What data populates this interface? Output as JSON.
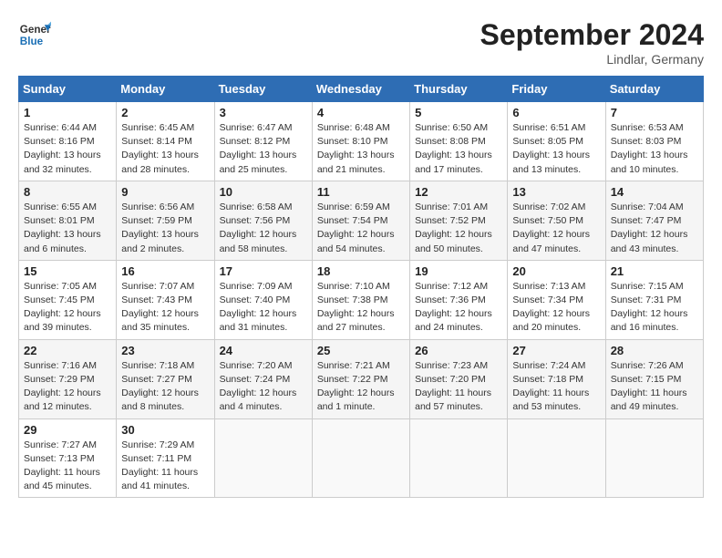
{
  "logo": {
    "line1": "General",
    "line2": "Blue"
  },
  "title": "September 2024",
  "location": "Lindlar, Germany",
  "headers": [
    "Sunday",
    "Monday",
    "Tuesday",
    "Wednesday",
    "Thursday",
    "Friday",
    "Saturday"
  ],
  "weeks": [
    [
      {
        "day": "1",
        "info": "Sunrise: 6:44 AM\nSunset: 8:16 PM\nDaylight: 13 hours\nand 32 minutes."
      },
      {
        "day": "2",
        "info": "Sunrise: 6:45 AM\nSunset: 8:14 PM\nDaylight: 13 hours\nand 28 minutes."
      },
      {
        "day": "3",
        "info": "Sunrise: 6:47 AM\nSunset: 8:12 PM\nDaylight: 13 hours\nand 25 minutes."
      },
      {
        "day": "4",
        "info": "Sunrise: 6:48 AM\nSunset: 8:10 PM\nDaylight: 13 hours\nand 21 minutes."
      },
      {
        "day": "5",
        "info": "Sunrise: 6:50 AM\nSunset: 8:08 PM\nDaylight: 13 hours\nand 17 minutes."
      },
      {
        "day": "6",
        "info": "Sunrise: 6:51 AM\nSunset: 8:05 PM\nDaylight: 13 hours\nand 13 minutes."
      },
      {
        "day": "7",
        "info": "Sunrise: 6:53 AM\nSunset: 8:03 PM\nDaylight: 13 hours\nand 10 minutes."
      }
    ],
    [
      {
        "day": "8",
        "info": "Sunrise: 6:55 AM\nSunset: 8:01 PM\nDaylight: 13 hours\nand 6 minutes."
      },
      {
        "day": "9",
        "info": "Sunrise: 6:56 AM\nSunset: 7:59 PM\nDaylight: 13 hours\nand 2 minutes."
      },
      {
        "day": "10",
        "info": "Sunrise: 6:58 AM\nSunset: 7:56 PM\nDaylight: 12 hours\nand 58 minutes."
      },
      {
        "day": "11",
        "info": "Sunrise: 6:59 AM\nSunset: 7:54 PM\nDaylight: 12 hours\nand 54 minutes."
      },
      {
        "day": "12",
        "info": "Sunrise: 7:01 AM\nSunset: 7:52 PM\nDaylight: 12 hours\nand 50 minutes."
      },
      {
        "day": "13",
        "info": "Sunrise: 7:02 AM\nSunset: 7:50 PM\nDaylight: 12 hours\nand 47 minutes."
      },
      {
        "day": "14",
        "info": "Sunrise: 7:04 AM\nSunset: 7:47 PM\nDaylight: 12 hours\nand 43 minutes."
      }
    ],
    [
      {
        "day": "15",
        "info": "Sunrise: 7:05 AM\nSunset: 7:45 PM\nDaylight: 12 hours\nand 39 minutes."
      },
      {
        "day": "16",
        "info": "Sunrise: 7:07 AM\nSunset: 7:43 PM\nDaylight: 12 hours\nand 35 minutes."
      },
      {
        "day": "17",
        "info": "Sunrise: 7:09 AM\nSunset: 7:40 PM\nDaylight: 12 hours\nand 31 minutes."
      },
      {
        "day": "18",
        "info": "Sunrise: 7:10 AM\nSunset: 7:38 PM\nDaylight: 12 hours\nand 27 minutes."
      },
      {
        "day": "19",
        "info": "Sunrise: 7:12 AM\nSunset: 7:36 PM\nDaylight: 12 hours\nand 24 minutes."
      },
      {
        "day": "20",
        "info": "Sunrise: 7:13 AM\nSunset: 7:34 PM\nDaylight: 12 hours\nand 20 minutes."
      },
      {
        "day": "21",
        "info": "Sunrise: 7:15 AM\nSunset: 7:31 PM\nDaylight: 12 hours\nand 16 minutes."
      }
    ],
    [
      {
        "day": "22",
        "info": "Sunrise: 7:16 AM\nSunset: 7:29 PM\nDaylight: 12 hours\nand 12 minutes."
      },
      {
        "day": "23",
        "info": "Sunrise: 7:18 AM\nSunset: 7:27 PM\nDaylight: 12 hours\nand 8 minutes."
      },
      {
        "day": "24",
        "info": "Sunrise: 7:20 AM\nSunset: 7:24 PM\nDaylight: 12 hours\nand 4 minutes."
      },
      {
        "day": "25",
        "info": "Sunrise: 7:21 AM\nSunset: 7:22 PM\nDaylight: 12 hours\nand 1 minute."
      },
      {
        "day": "26",
        "info": "Sunrise: 7:23 AM\nSunset: 7:20 PM\nDaylight: 11 hours\nand 57 minutes."
      },
      {
        "day": "27",
        "info": "Sunrise: 7:24 AM\nSunset: 7:18 PM\nDaylight: 11 hours\nand 53 minutes."
      },
      {
        "day": "28",
        "info": "Sunrise: 7:26 AM\nSunset: 7:15 PM\nDaylight: 11 hours\nand 49 minutes."
      }
    ],
    [
      {
        "day": "29",
        "info": "Sunrise: 7:27 AM\nSunset: 7:13 PM\nDaylight: 11 hours\nand 45 minutes."
      },
      {
        "day": "30",
        "info": "Sunrise: 7:29 AM\nSunset: 7:11 PM\nDaylight: 11 hours\nand 41 minutes."
      },
      {
        "day": "",
        "info": ""
      },
      {
        "day": "",
        "info": ""
      },
      {
        "day": "",
        "info": ""
      },
      {
        "day": "",
        "info": ""
      },
      {
        "day": "",
        "info": ""
      }
    ]
  ]
}
